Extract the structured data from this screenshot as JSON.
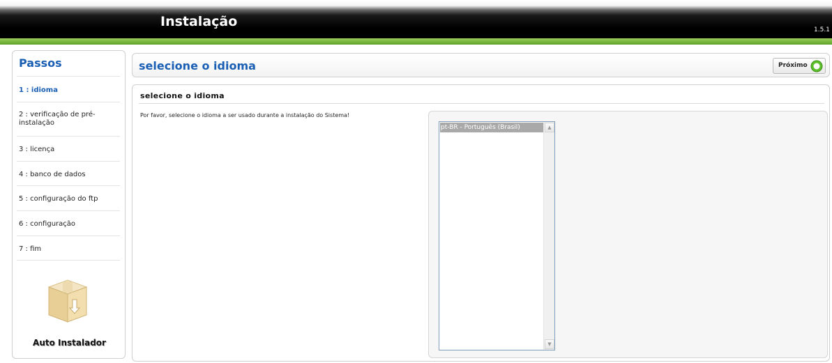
{
  "header": {
    "title": "Instalação",
    "version": "1.5.1"
  },
  "sidebar": {
    "title": "Passos",
    "steps": [
      {
        "label": "1 : idioma",
        "active": true
      },
      {
        "label": "2 : verificação de pré-instalação",
        "active": false
      },
      {
        "label": "3 : licença",
        "active": false
      },
      {
        "label": "4 : banco de dados",
        "active": false
      },
      {
        "label": "5 : configuração do ftp",
        "active": false
      },
      {
        "label": "6 : configuração",
        "active": false
      },
      {
        "label": "7 : fim",
        "active": false
      }
    ],
    "logo_label": "Auto Instalador"
  },
  "title_panel": {
    "title": "selecione o idioma",
    "next_label": "Próximo"
  },
  "main": {
    "heading": "selecione o idioma",
    "instructions": "Por favor, selecione o idioma a ser usado durante a instalação do Sistema!",
    "languages": [
      "pt-BR - Português (Brasil)"
    ],
    "selected_language": "pt-BR - Português (Brasil)"
  },
  "colors": {
    "accent_blue": "#1a5fb4",
    "header_green": "#7cbf3f",
    "next_icon_green": "#5cbf2a"
  },
  "icons": {
    "next": "arrow-right-circle-icon",
    "logo": "box-download-icon",
    "scroll_up": "chevron-up-icon",
    "scroll_down": "chevron-down-icon"
  }
}
